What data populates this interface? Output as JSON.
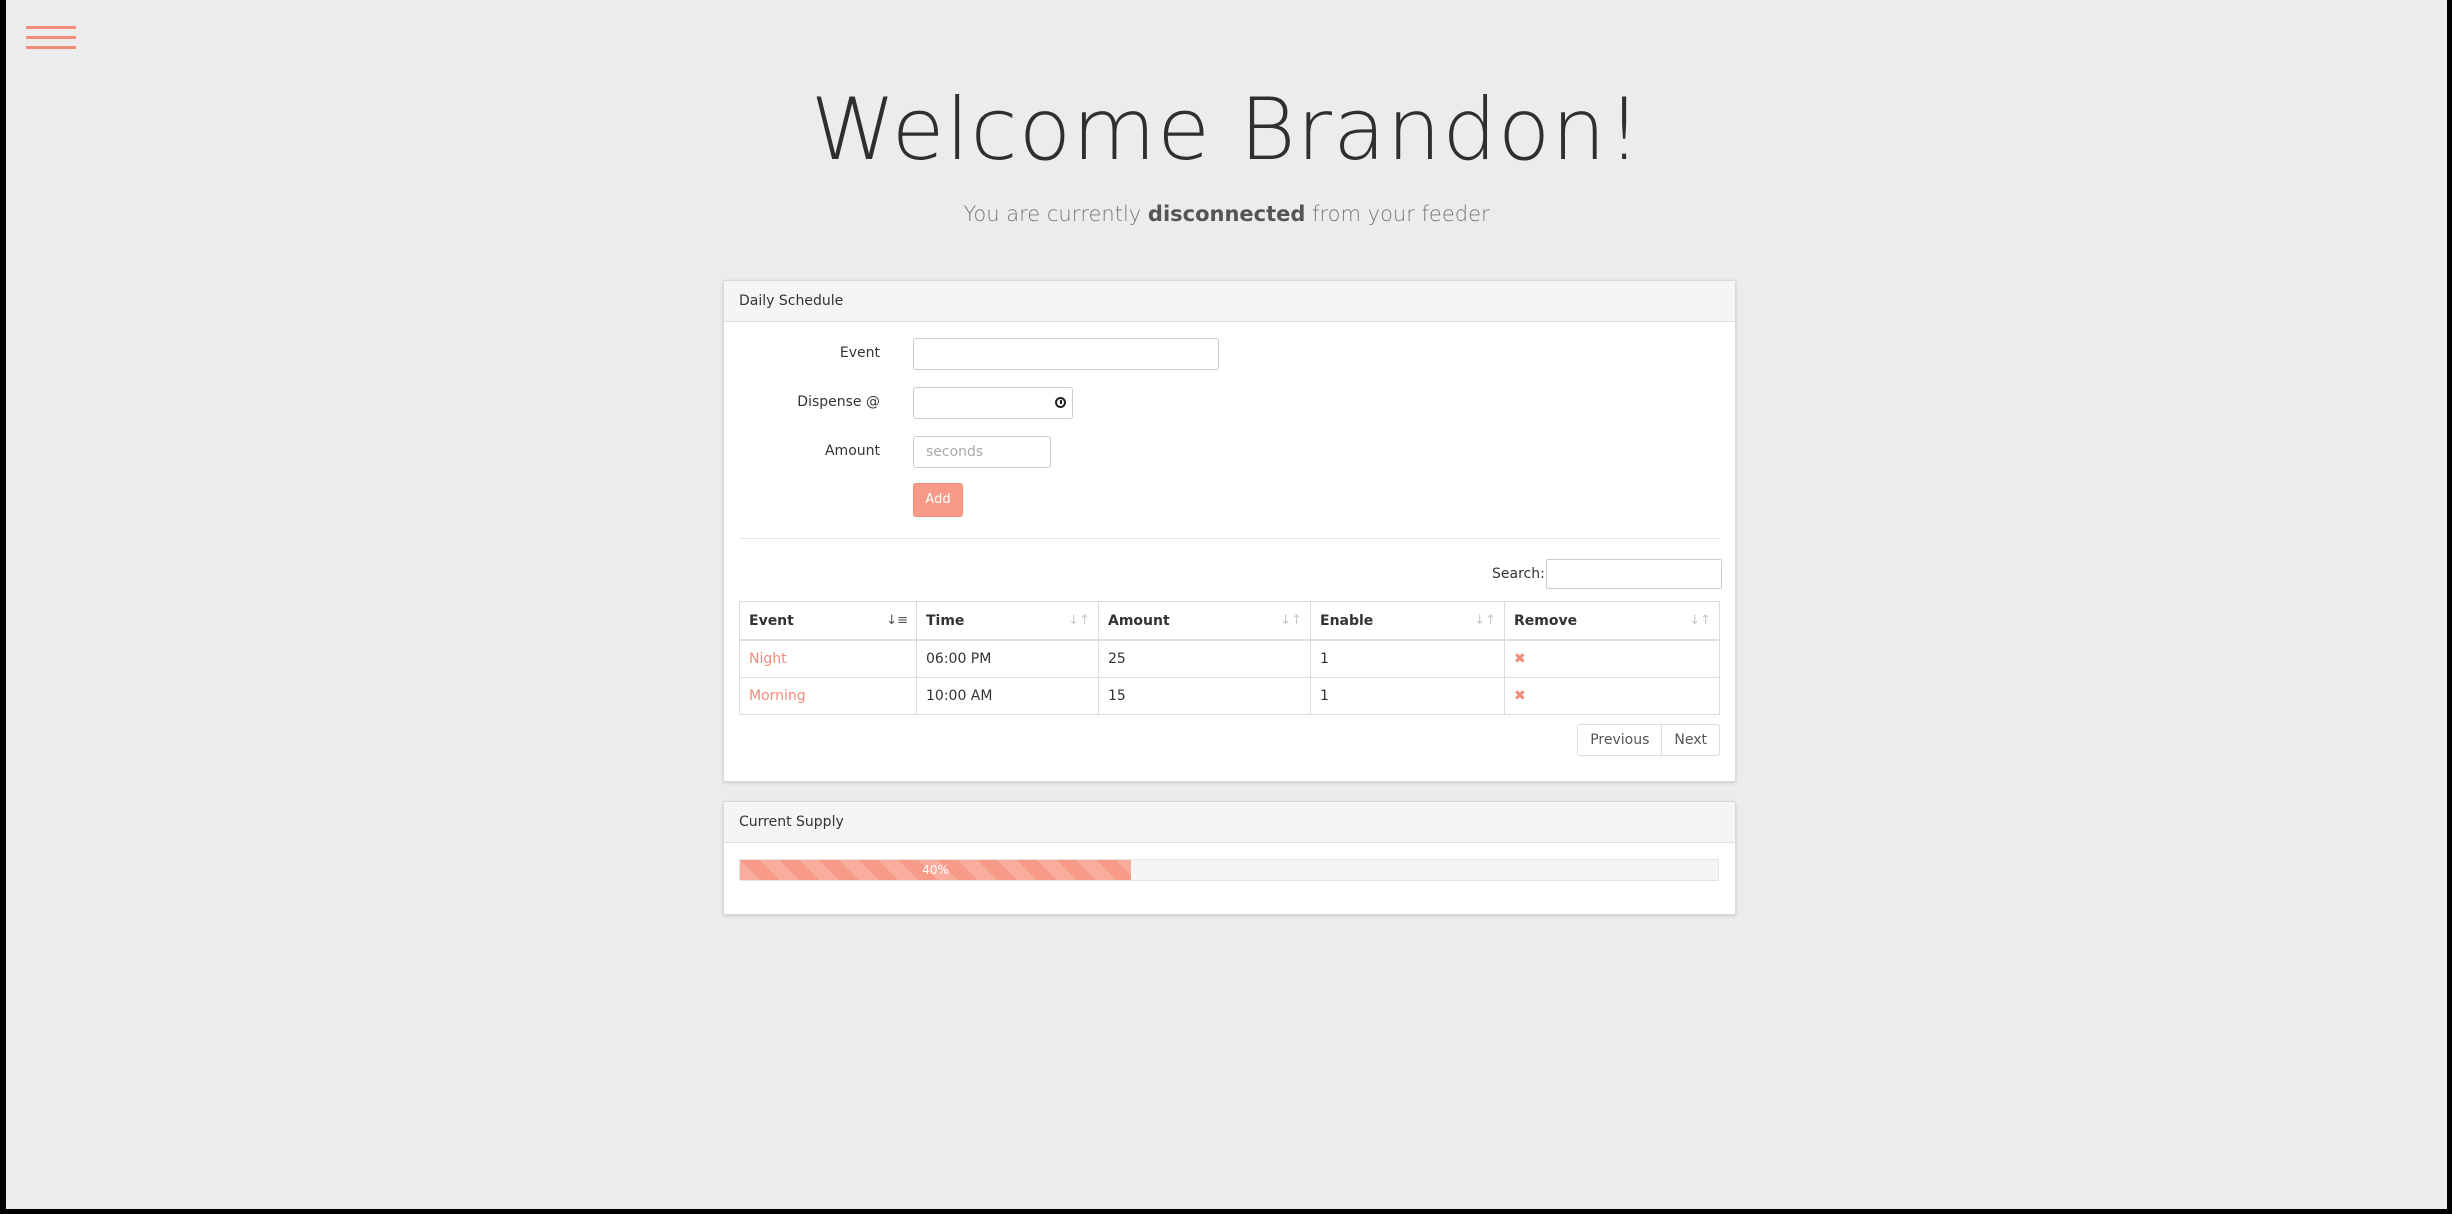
{
  "header": {
    "title": "Welcome Brandon!",
    "subtitle_pre": "You are currently ",
    "subtitle_status": "disconnected",
    "subtitle_post": " from your feeder"
  },
  "schedule_panel": {
    "title": "Daily Schedule",
    "form": {
      "event_label": "Event",
      "event_value": "",
      "dispense_label": "Dispense @",
      "dispense_value": "",
      "amount_label": "Amount",
      "amount_placeholder": "seconds",
      "add_label": "Add"
    },
    "search_label": "Search:",
    "search_value": "",
    "table": {
      "columns": [
        "Event",
        "Time",
        "Amount",
        "Enable",
        "Remove"
      ],
      "rows": [
        {
          "event": "Night",
          "time": "06:00 PM",
          "amount": "25",
          "enable": "1",
          "remove": "✖"
        },
        {
          "event": "Morning",
          "time": "10:00 AM",
          "amount": "15",
          "enable": "1",
          "remove": "✖"
        }
      ]
    },
    "pager": {
      "previous": "Previous",
      "next": "Next"
    }
  },
  "supply_panel": {
    "title": "Current Supply",
    "progress_value": 40,
    "progress_label": "40%"
  },
  "colors": {
    "accent": "#f79b88",
    "background": "#ececec"
  },
  "icons": {
    "menu": "hamburger-menu-icon",
    "time": "clock-icon",
    "remove": "remove-x-icon",
    "sort": "sort-icon"
  }
}
